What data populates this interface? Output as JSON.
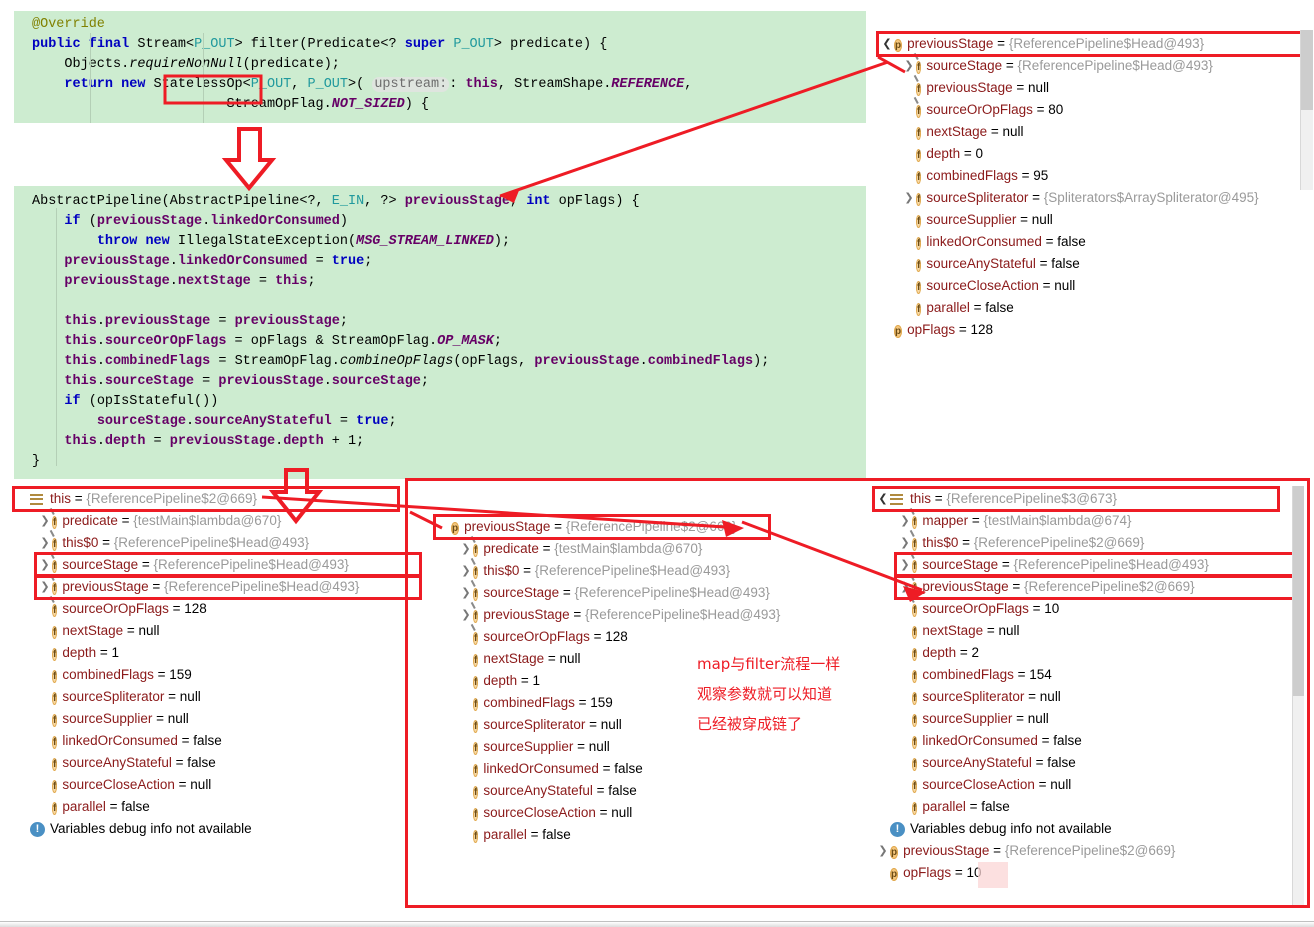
{
  "code_blocks": [
    {
      "name": "filter-method-source",
      "lines": [
        "@Override",
        "public final Stream<P_OUT> filter(Predicate<? super P_OUT> predicate) {",
        "    Objects.requireNonNull(predicate);",
        "    return new StatelessOp<P_OUT, P_OUT>( upstream: this, StreamShape.REFERENCE,",
        "                        StreamOpFlag.NOT_SIZED) {"
      ],
      "highlight_token": "StatelessOp",
      "param_hint": "upstream:"
    },
    {
      "name": "abstract-pipeline-constructor-source",
      "lines": [
        "AbstractPipeline(AbstractPipeline<?, E_IN, ?> previousStage, int opFlags) {",
        "    if (previousStage.linkedOrConsumed)",
        "        throw new IllegalStateException(MSG_STREAM_LINKED);",
        "    previousStage.linkedOrConsumed = true;",
        "    previousStage.nextStage = this;",
        "",
        "    this.previousStage = previousStage;",
        "    this.sourceOrOpFlags = opFlags & StreamOpFlag.OP_MASK;",
        "    this.combinedFlags = StreamOpFlag.combineOpFlags(opFlags, previousStage.combinedFlags);",
        "    this.sourceStage = previousStage.sourceStage;",
        "    if (opIsStateful())",
        "        sourceStage.sourceAnyStateful = true;",
        "    this.depth = previousStage.depth + 1;",
        "}"
      ]
    }
  ],
  "panels": {
    "top_right": {
      "title": "debugger-variables-top-right",
      "rows": [
        {
          "chev": "down",
          "icon": "p",
          "name": "previousStage",
          "eq": "=",
          "value": "{ReferencePipeline$Head@493}",
          "value_kind": "ref",
          "indent": 0,
          "highlight": true
        },
        {
          "chev": "right",
          "icon": "f-pin",
          "name": "sourceStage",
          "eq": "=",
          "value": "{ReferencePipeline$Head@493}",
          "value_kind": "ref",
          "indent": 1
        },
        {
          "chev": "none",
          "icon": "f-pin",
          "name": "previousStage",
          "eq": "=",
          "value": "null",
          "value_kind": "plain",
          "indent": 1
        },
        {
          "chev": "none",
          "icon": "f-pin",
          "name": "sourceOrOpFlags",
          "eq": "=",
          "value": "80",
          "value_kind": "plain",
          "indent": 1
        },
        {
          "chev": "none",
          "icon": "f",
          "name": "nextStage",
          "eq": "=",
          "value": "null",
          "value_kind": "plain",
          "indent": 1
        },
        {
          "chev": "none",
          "icon": "f",
          "name": "depth",
          "eq": "=",
          "value": "0",
          "value_kind": "plain",
          "indent": 1
        },
        {
          "chev": "none",
          "icon": "f",
          "name": "combinedFlags",
          "eq": "=",
          "value": "95",
          "value_kind": "plain",
          "indent": 1
        },
        {
          "chev": "right",
          "icon": "f",
          "name": "sourceSpliterator",
          "eq": "=",
          "value": "{Spliterators$ArraySpliterator@495}",
          "value_kind": "ref",
          "indent": 1
        },
        {
          "chev": "none",
          "icon": "f",
          "name": "sourceSupplier",
          "eq": "=",
          "value": "null",
          "value_kind": "plain",
          "indent": 1
        },
        {
          "chev": "none",
          "icon": "f",
          "name": "linkedOrConsumed",
          "eq": "=",
          "value": "false",
          "value_kind": "plain",
          "indent": 1
        },
        {
          "chev": "none",
          "icon": "f",
          "name": "sourceAnyStateful",
          "eq": "=",
          "value": "false",
          "value_kind": "plain",
          "indent": 1
        },
        {
          "chev": "none",
          "icon": "f",
          "name": "sourceCloseAction",
          "eq": "=",
          "value": "null",
          "value_kind": "plain",
          "indent": 1
        },
        {
          "chev": "none",
          "icon": "f",
          "name": "parallel",
          "eq": "=",
          "value": "false",
          "value_kind": "plain",
          "indent": 1
        },
        {
          "chev": "none",
          "icon": "p",
          "name": "opFlags",
          "eq": "=",
          "value": "128",
          "value_kind": "plain",
          "indent": 0
        }
      ]
    },
    "bottom_left": {
      "title": "debugger-variables-bottom-left",
      "rows": [
        {
          "chev": "none",
          "icon": "lines",
          "name": "this",
          "eq": "=",
          "value": "{ReferencePipeline$2@669}",
          "value_kind": "ref",
          "indent": 0,
          "highlight": true
        },
        {
          "chev": "right",
          "icon": "f-pin",
          "name": "predicate",
          "eq": "=",
          "value": "{testMain$lambda@670}",
          "value_kind": "ref",
          "indent": 1
        },
        {
          "chev": "right",
          "icon": "f-pin",
          "name": "this$0",
          "eq": "=",
          "value": "{ReferencePipeline$Head@493}",
          "value_kind": "ref",
          "indent": 1
        },
        {
          "chev": "right",
          "icon": "f-pin",
          "name": "sourceStage",
          "eq": "=",
          "value": "{ReferencePipeline$Head@493}",
          "value_kind": "ref",
          "indent": 1,
          "highlight": true
        },
        {
          "chev": "right",
          "icon": "f-pin",
          "name": "previousStage",
          "eq": "=",
          "value": "{ReferencePipeline$Head@493}",
          "value_kind": "ref",
          "indent": 1,
          "highlight": true
        },
        {
          "chev": "none",
          "icon": "f-pin",
          "name": "sourceOrOpFlags",
          "eq": "=",
          "value": "128",
          "value_kind": "plain",
          "indent": 1
        },
        {
          "chev": "none",
          "icon": "f",
          "name": "nextStage",
          "eq": "=",
          "value": "null",
          "value_kind": "plain",
          "indent": 1
        },
        {
          "chev": "none",
          "icon": "f",
          "name": "depth",
          "eq": "=",
          "value": "1",
          "value_kind": "plain",
          "indent": 1
        },
        {
          "chev": "none",
          "icon": "f",
          "name": "combinedFlags",
          "eq": "=",
          "value": "159",
          "value_kind": "plain",
          "indent": 1
        },
        {
          "chev": "none",
          "icon": "f",
          "name": "sourceSpliterator",
          "eq": "=",
          "value": "null",
          "value_kind": "plain",
          "indent": 1
        },
        {
          "chev": "none",
          "icon": "f",
          "name": "sourceSupplier",
          "eq": "=",
          "value": "null",
          "value_kind": "plain",
          "indent": 1
        },
        {
          "chev": "none",
          "icon": "f",
          "name": "linkedOrConsumed",
          "eq": "=",
          "value": "false",
          "value_kind": "plain",
          "indent": 1
        },
        {
          "chev": "none",
          "icon": "f",
          "name": "sourceAnyStateful",
          "eq": "=",
          "value": "false",
          "value_kind": "plain",
          "indent": 1
        },
        {
          "chev": "none",
          "icon": "f",
          "name": "sourceCloseAction",
          "eq": "=",
          "value": "null",
          "value_kind": "plain",
          "indent": 1
        },
        {
          "chev": "none",
          "icon": "f",
          "name": "parallel",
          "eq": "=",
          "value": "false",
          "value_kind": "plain",
          "indent": 1
        },
        {
          "chev": "none",
          "icon": "info",
          "name": "",
          "eq": "",
          "value": "Variables debug info not available",
          "value_kind": "note",
          "indent": 0
        }
      ]
    },
    "bottom_middle": {
      "title": "debugger-variables-bottom-middle",
      "rows": [
        {
          "chev": "none",
          "icon": "p",
          "name": "previousStage",
          "eq": "=",
          "value": "{ReferencePipeline$2@669}",
          "value_kind": "ref",
          "indent": 0,
          "highlight": true
        },
        {
          "chev": "right",
          "icon": "f-pin",
          "name": "predicate",
          "eq": "=",
          "value": "{testMain$lambda@670}",
          "value_kind": "ref",
          "indent": 1
        },
        {
          "chev": "right",
          "icon": "f-pin",
          "name": "this$0",
          "eq": "=",
          "value": "{ReferencePipeline$Head@493}",
          "value_kind": "ref",
          "indent": 1
        },
        {
          "chev": "right",
          "icon": "f-pin",
          "name": "sourceStage",
          "eq": "=",
          "value": "{ReferencePipeline$Head@493}",
          "value_kind": "ref",
          "indent": 1
        },
        {
          "chev": "right",
          "icon": "f-pin",
          "name": "previousStage",
          "eq": "=",
          "value": "{ReferencePipeline$Head@493}",
          "value_kind": "ref",
          "indent": 1
        },
        {
          "chev": "none",
          "icon": "f-pin",
          "name": "sourceOrOpFlags",
          "eq": "=",
          "value": "128",
          "value_kind": "plain",
          "indent": 1
        },
        {
          "chev": "none",
          "icon": "f",
          "name": "nextStage",
          "eq": "=",
          "value": "null",
          "value_kind": "plain",
          "indent": 1
        },
        {
          "chev": "none",
          "icon": "f",
          "name": "depth",
          "eq": "=",
          "value": "1",
          "value_kind": "plain",
          "indent": 1
        },
        {
          "chev": "none",
          "icon": "f",
          "name": "combinedFlags",
          "eq": "=",
          "value": "159",
          "value_kind": "plain",
          "indent": 1
        },
        {
          "chev": "none",
          "icon": "f",
          "name": "sourceSpliterator",
          "eq": "=",
          "value": "null",
          "value_kind": "plain",
          "indent": 1
        },
        {
          "chev": "none",
          "icon": "f",
          "name": "sourceSupplier",
          "eq": "=",
          "value": "null",
          "value_kind": "plain",
          "indent": 1
        },
        {
          "chev": "none",
          "icon": "f",
          "name": "linkedOrConsumed",
          "eq": "=",
          "value": "false",
          "value_kind": "plain",
          "indent": 1
        },
        {
          "chev": "none",
          "icon": "f",
          "name": "sourceAnyStateful",
          "eq": "=",
          "value": "false",
          "value_kind": "plain",
          "indent": 1
        },
        {
          "chev": "none",
          "icon": "f",
          "name": "sourceCloseAction",
          "eq": "=",
          "value": "null",
          "value_kind": "plain",
          "indent": 1
        },
        {
          "chev": "none",
          "icon": "f",
          "name": "parallel",
          "eq": "=",
          "value": "false",
          "value_kind": "plain",
          "indent": 1
        }
      ]
    },
    "bottom_right": {
      "title": "debugger-variables-bottom-right",
      "rows": [
        {
          "chev": "down",
          "icon": "lines",
          "name": "this",
          "eq": "=",
          "value": "{ReferencePipeline$3@673}",
          "value_kind": "ref",
          "indent": 0,
          "highlight": true
        },
        {
          "chev": "right",
          "icon": "f-pin",
          "name": "mapper",
          "eq": "=",
          "value": "{testMain$lambda@674}",
          "value_kind": "ref",
          "indent": 1
        },
        {
          "chev": "right",
          "icon": "f-pin",
          "name": "this$0",
          "eq": "=",
          "value": "{ReferencePipeline$2@669}",
          "value_kind": "ref",
          "indent": 1
        },
        {
          "chev": "right",
          "icon": "f-pin",
          "name": "sourceStage",
          "eq": "=",
          "value": "{ReferencePipeline$Head@493}",
          "value_kind": "ref",
          "indent": 1,
          "highlight": true
        },
        {
          "chev": "right",
          "icon": "f-pin",
          "name": "previousStage",
          "eq": "=",
          "value": "{ReferencePipeline$2@669}",
          "value_kind": "ref",
          "indent": 1,
          "highlight": true
        },
        {
          "chev": "none",
          "icon": "f-pin",
          "name": "sourceOrOpFlags",
          "eq": "=",
          "value": "10",
          "value_kind": "plain",
          "indent": 1
        },
        {
          "chev": "none",
          "icon": "f",
          "name": "nextStage",
          "eq": "=",
          "value": "null",
          "value_kind": "plain",
          "indent": 1
        },
        {
          "chev": "none",
          "icon": "f",
          "name": "depth",
          "eq": "=",
          "value": "2",
          "value_kind": "plain",
          "indent": 1
        },
        {
          "chev": "none",
          "icon": "f",
          "name": "combinedFlags",
          "eq": "=",
          "value": "154",
          "value_kind": "plain",
          "indent": 1
        },
        {
          "chev": "none",
          "icon": "f",
          "name": "sourceSpliterator",
          "eq": "=",
          "value": "null",
          "value_kind": "plain",
          "indent": 1
        },
        {
          "chev": "none",
          "icon": "f",
          "name": "sourceSupplier",
          "eq": "=",
          "value": "null",
          "value_kind": "plain",
          "indent": 1
        },
        {
          "chev": "none",
          "icon": "f",
          "name": "linkedOrConsumed",
          "eq": "=",
          "value": "false",
          "value_kind": "plain",
          "indent": 1
        },
        {
          "chev": "none",
          "icon": "f",
          "name": "sourceAnyStateful",
          "eq": "=",
          "value": "false",
          "value_kind": "plain",
          "indent": 1
        },
        {
          "chev": "none",
          "icon": "f",
          "name": "sourceCloseAction",
          "eq": "=",
          "value": "null",
          "value_kind": "plain",
          "indent": 1
        },
        {
          "chev": "none",
          "icon": "f",
          "name": "parallel",
          "eq": "=",
          "value": "false",
          "value_kind": "plain",
          "indent": 1
        },
        {
          "chev": "none",
          "icon": "info",
          "name": "",
          "eq": "",
          "value": "Variables debug info not available",
          "value_kind": "note",
          "indent": 0
        },
        {
          "chev": "right",
          "icon": "p",
          "name": "previousStage",
          "eq": "=",
          "value": "{ReferencePipeline$2@669}",
          "value_kind": "ref",
          "indent": 0
        },
        {
          "chev": "none",
          "icon": "p",
          "name": "opFlags",
          "eq": "=",
          "value": "10",
          "value_kind": "plain",
          "indent": 0
        }
      ]
    }
  },
  "annotation": {
    "line1": "map与filter流程一样",
    "line2": "观察参数就可以知道",
    "line3": "已经被穿成链了",
    "color": "#ee1c25"
  },
  "colors": {
    "code_background": "#cdecd0",
    "highlight_red": "#ee1c25",
    "variable_name": "#8b1a1a",
    "reference_gray": "#9a9a9a",
    "badge_orange": "#f5c77e",
    "info_blue": "#4a90c4"
  }
}
